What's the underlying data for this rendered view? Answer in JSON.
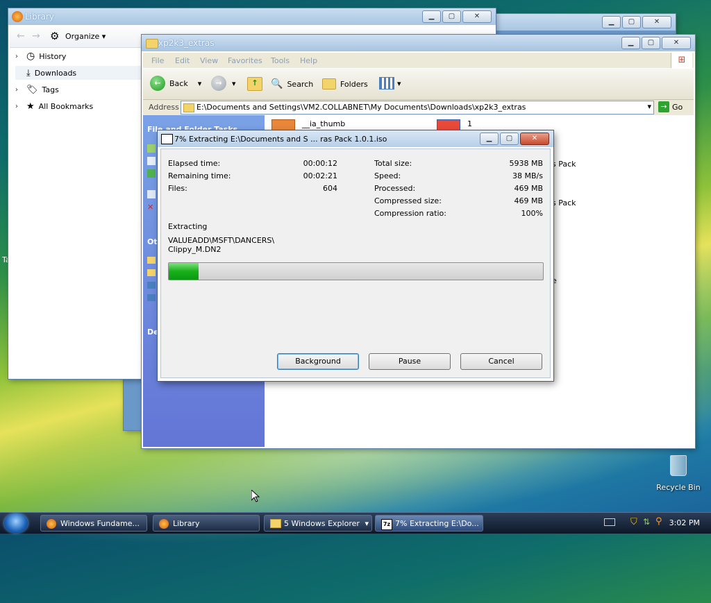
{
  "colors": {
    "accent": "#3c7fb1",
    "progress": "#18b01a",
    "taskbar": "#1d2c45"
  },
  "library": {
    "title": "Library",
    "organize": "Organize",
    "items": [
      {
        "label": "History",
        "icon": "clock-icon",
        "expandable": true
      },
      {
        "label": "Downloads",
        "icon": "download-icon",
        "expandable": false,
        "selected": true
      },
      {
        "label": "Tags",
        "icon": "tag-icon",
        "expandable": true
      },
      {
        "label": "All Bookmarks",
        "icon": "star-icon",
        "expandable": true
      }
    ]
  },
  "explorer": {
    "title": "xp2k3_extras",
    "menu": [
      "File",
      "Edit",
      "View",
      "Favorites",
      "Tools",
      "Help"
    ],
    "toolbar": {
      "back": "Back",
      "search": "Search",
      "folders": "Folders"
    },
    "address_label": "Address",
    "address_value": "E:\\Documents and Settings\\VM2.COLLABNET\\My Documents\\Downloads\\xp2k3_extras",
    "go": "Go",
    "task_pane": {
      "header": "File and Folder Tasks",
      "other": "Ot",
      "details": "De"
    },
    "files": [
      "__ia_thumb",
      "1"
    ],
    "partial_labels": [
      "s Pack",
      "s Pack",
      "e"
    ]
  },
  "extract": {
    "title": "7% Extracting E:\\Documents and S ... ras Pack 1.0.1.iso",
    "left": [
      {
        "label": "Elapsed time:",
        "value": "00:00:12"
      },
      {
        "label": "Remaining time:",
        "value": "00:02:21"
      },
      {
        "label": "Files:",
        "value": "604"
      }
    ],
    "right": [
      {
        "label": "Total size:",
        "value": "5938 MB"
      },
      {
        "label": "Speed:",
        "value": "38 MB/s"
      },
      {
        "label": "Processed:",
        "value": "469 MB"
      },
      {
        "label": "Compressed size:",
        "value": "469 MB"
      },
      {
        "label": "Compression ratio:",
        "value": "100%"
      }
    ],
    "status": "Extracting",
    "path_line1": "VALUEADD\\MSFT\\DANCERS\\",
    "path_line2": "Clippy_M.DN2",
    "progress_fraction": 0.08,
    "buttons": {
      "background": "Background",
      "pause": "Pause",
      "cancel": "Cancel"
    }
  },
  "taskbar": {
    "items": [
      {
        "label": "Windows Fundame...",
        "icon": "firefox-icon"
      },
      {
        "label": "Library",
        "icon": "firefox-icon"
      },
      {
        "label": "5 Windows Explorer",
        "icon": "folder-icon"
      },
      {
        "label": "7% Extracting E:\\Do...",
        "icon": "7zip-icon"
      }
    ],
    "clock": "3:02 PM"
  },
  "desktop": {
    "recycle_bin": "Recycle Bin",
    "partial_text": "Ta"
  }
}
